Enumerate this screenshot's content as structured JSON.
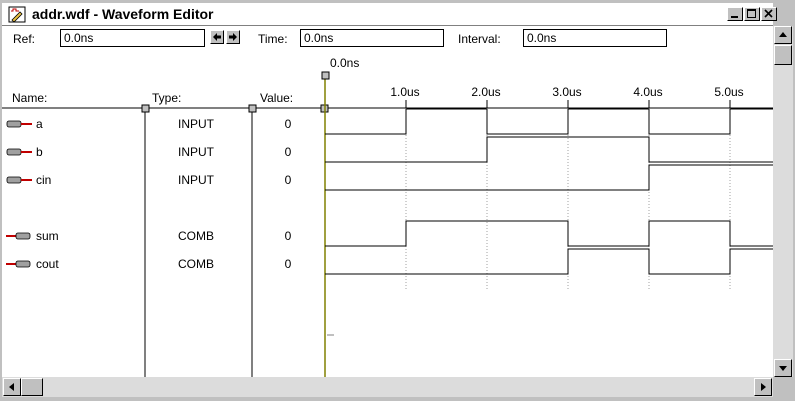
{
  "window": {
    "title": "addr.wdf - Waveform Editor"
  },
  "toolbar": {
    "ref_label": "Ref:",
    "ref_value": "0.0ns",
    "time_label": "Time:",
    "time_value": "0.0ns",
    "interval_label": "Interval:",
    "interval_value": "0.0ns"
  },
  "headers": {
    "name": "Name:",
    "type": "Type:",
    "value": "Value:"
  },
  "cursor_label": "0.0ns",
  "time_ticks": [
    "1.0us",
    "2.0us",
    "3.0us",
    "4.0us",
    "5.0us"
  ],
  "signals": [
    {
      "name": "a",
      "type": "INPUT",
      "value": "0",
      "kind": "input",
      "transitions": [
        0,
        1,
        0,
        1,
        0,
        1
      ]
    },
    {
      "name": "b",
      "type": "INPUT",
      "value": "0",
      "kind": "input",
      "transitions": [
        0,
        0,
        1,
        1,
        0,
        0
      ]
    },
    {
      "name": "cin",
      "type": "INPUT",
      "value": "0",
      "kind": "input",
      "transitions": [
        0,
        0,
        0,
        0,
        1,
        1
      ]
    },
    {
      "name": "sum",
      "type": "COMB",
      "value": "0",
      "kind": "comb",
      "transitions": [
        0,
        1,
        1,
        0,
        1,
        0
      ]
    },
    {
      "name": "cout",
      "type": "COMB",
      "value": "0",
      "kind": "comb",
      "transitions": [
        0,
        0,
        0,
        1,
        0,
        1
      ]
    }
  ],
  "colors": {
    "cursor": "#808000",
    "pin_input": "#c00000",
    "pin_comb": "#c00000"
  }
}
